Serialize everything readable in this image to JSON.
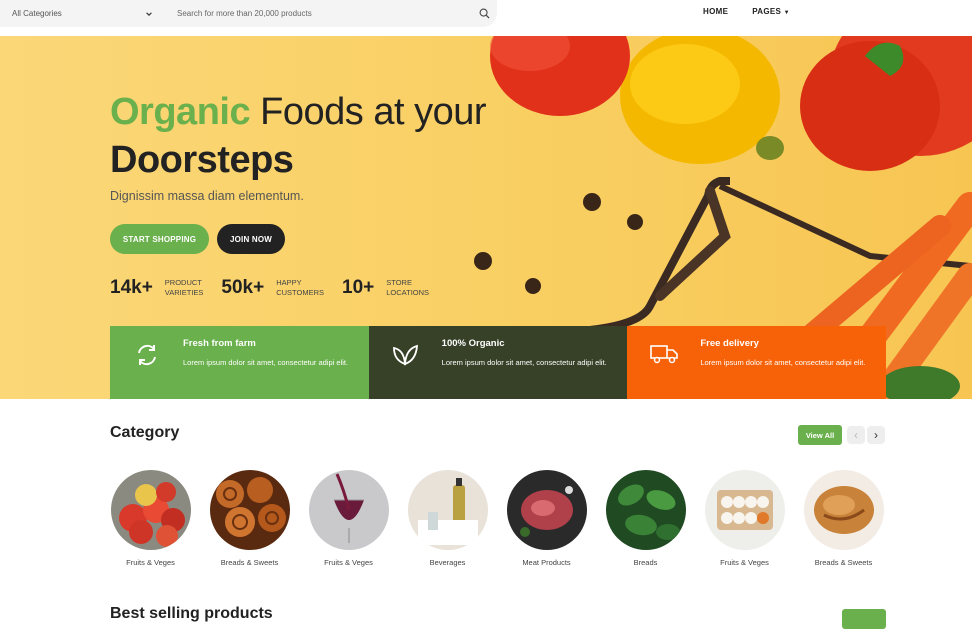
{
  "header": {
    "category_select": "All Categories",
    "search_placeholder": "Search for more than 20,000 products",
    "nav": [
      "HOME",
      "PAGES"
    ]
  },
  "hero": {
    "title_highlight": "Organic",
    "title_rest1": " Foods at your",
    "title_line2": "Doorsteps",
    "subtitle": "Dignissim massa diam elementum.",
    "btn_shop": "START SHOPPING",
    "btn_join": "JOIN NOW",
    "stats": [
      {
        "num": "14k+",
        "label": "PRODUCT\nVARIETIES"
      },
      {
        "num": "50k+",
        "label": "HAPPY\nCUSTOMERS"
      },
      {
        "num": "10+",
        "label": "STORE\nLOCATIONS"
      }
    ]
  },
  "features": [
    {
      "title": "Fresh from farm",
      "desc": "Lorem ipsum dolor sit amet, consectetur adipi elit.",
      "icon": "refresh-icon",
      "color": "#6ab04c"
    },
    {
      "title": "100% Organic",
      "desc": "Lorem ipsum dolor sit amet, consectetur adipi elit.",
      "icon": "leaf-icon",
      "color": "#364127"
    },
    {
      "title": "Free delivery",
      "desc": "Lorem ipsum dolor sit amet, consectetur adipi elit.",
      "icon": "truck-icon",
      "color": "#f76208"
    }
  ],
  "category": {
    "heading": "Category",
    "view_all": "View All",
    "prev": "‹",
    "next": "›",
    "items": [
      {
        "label": "Fruits & Veges"
      },
      {
        "label": "Breads & Sweets"
      },
      {
        "label": "Fruits & Veges"
      },
      {
        "label": "Beverages"
      },
      {
        "label": "Meat Products"
      },
      {
        "label": "Breads"
      },
      {
        "label": "Fruits & Veges"
      },
      {
        "label": "Breads & Sweets"
      }
    ]
  },
  "best_selling": {
    "heading": "Best selling products"
  }
}
